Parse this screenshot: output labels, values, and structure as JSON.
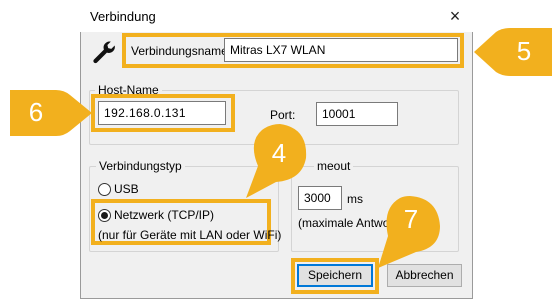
{
  "window": {
    "title": "Verbindung",
    "close_icon": "×"
  },
  "connection_name": {
    "label": "Verbindungsname",
    "value": "Mitras LX7 WLAN"
  },
  "host": {
    "group_label": "Host-Name",
    "value": "192.168.0.131",
    "port_label": "Port:",
    "port_value": "10001"
  },
  "connection_type": {
    "group_label": "Verbindungstyp",
    "usb_label": "USB",
    "network_label": "Netzwerk (TCP/IP)",
    "network_note": "(nur für Geräte mit LAN oder WiFi)",
    "selected": "network"
  },
  "timeout": {
    "group_label": "meout",
    "value": "3000",
    "unit": "ms",
    "note": "(maximale Antwort"
  },
  "buttons": {
    "save": "Speichern",
    "cancel": "Abbrechen"
  },
  "callouts": {
    "c4": "4",
    "c5": "5",
    "c6": "6",
    "c7": "7"
  },
  "colors": {
    "callout": "#f2b01e",
    "focus_blue": "#0078d7"
  },
  "icons": {
    "wrench": "wrench-icon",
    "close": "close-icon"
  }
}
